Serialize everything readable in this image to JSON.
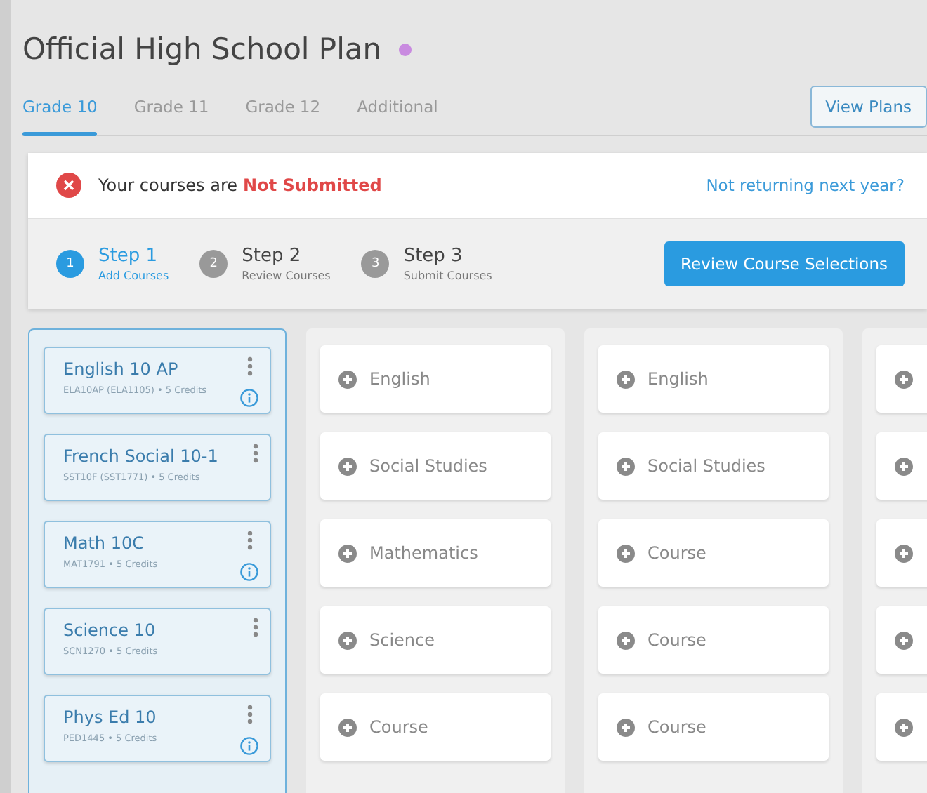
{
  "title": "Official High School Plan",
  "tabs": [
    {
      "label": "Grade 10",
      "selected": true
    },
    {
      "label": "Grade 11",
      "selected": false
    },
    {
      "label": "Grade 12",
      "selected": false
    },
    {
      "label": "Additional",
      "selected": false
    }
  ],
  "view_plans_button": "View Plans",
  "status": {
    "message": "Your courses are",
    "state": "Not Submitted",
    "link": "Not returning next year?"
  },
  "steps": [
    {
      "number": "1",
      "title": "Step 1",
      "subtitle": "Add Courses",
      "selected": true
    },
    {
      "number": "2",
      "title": "Step 2",
      "subtitle": "Review Courses",
      "selected": false
    },
    {
      "number": "3",
      "title": "Step 3",
      "subtitle": "Submit Courses",
      "selected": false
    }
  ],
  "review_button": "Review Course Selections",
  "columns": [
    {
      "kind": "planned",
      "selected": true,
      "courses": [
        {
          "name": "English 10 AP",
          "detail": "ELA10AP (ELA1105) • 5 Credits",
          "info": true
        },
        {
          "name": "French Social 10-1",
          "detail": "SST10F (SST1771) • 5 Credits",
          "info": false
        },
        {
          "name": "Math 10C",
          "detail": "MAT1791 • 5 Credits",
          "info": true
        },
        {
          "name": "Science 10",
          "detail": "SCN1270 • 5 Credits",
          "info": false
        },
        {
          "name": "Phys Ed 10",
          "detail": "PED1445 • 5 Credits",
          "info": true
        }
      ]
    },
    {
      "kind": "open",
      "selected": false,
      "slots": [
        {
          "kind": "add",
          "label": "English"
        },
        {
          "kind": "add",
          "label": "Social Studies"
        },
        {
          "kind": "add",
          "label": "Mathematics"
        },
        {
          "kind": "add",
          "label": "Science"
        },
        {
          "kind": "add",
          "label": "Course"
        }
      ]
    },
    {
      "kind": "open",
      "selected": false,
      "slots": [
        {
          "kind": "add",
          "label": "English"
        },
        {
          "kind": "add",
          "label": "Social Studies"
        },
        {
          "kind": "add",
          "label": "Course"
        },
        {
          "kind": "add",
          "label": "Course"
        },
        {
          "kind": "add",
          "label": "Course"
        }
      ]
    },
    {
      "kind": "open",
      "selected": false,
      "slots": [
        {
          "kind": "add"
        },
        {
          "kind": "add"
        },
        {
          "kind": "add"
        },
        {
          "kind": "add"
        },
        {
          "kind": "add"
        }
      ]
    }
  ]
}
